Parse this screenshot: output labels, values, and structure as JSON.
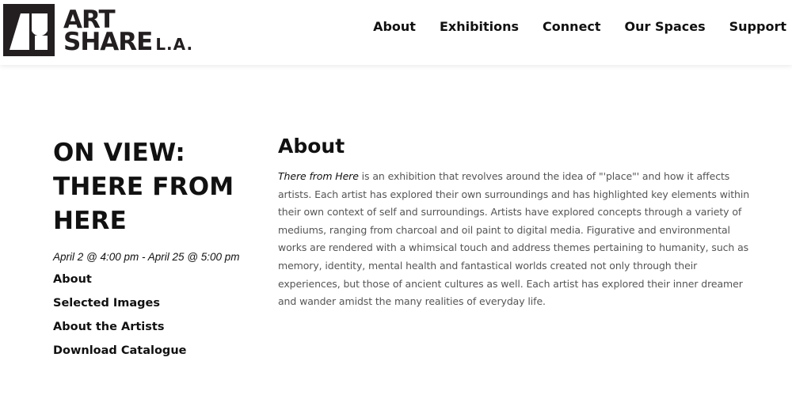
{
  "header": {
    "logo": {
      "line1": "ART",
      "line2": "SHARE",
      "suffix": "L.A."
    },
    "nav": [
      {
        "label": "About"
      },
      {
        "label": "Exhibitions"
      },
      {
        "label": "Connect"
      },
      {
        "label": "Our Spaces"
      },
      {
        "label": "Support"
      }
    ]
  },
  "sidebar": {
    "title": "ON VIEW: THERE FROM HERE",
    "date": "April 2 @ 4:00 pm - April 25 @ 5:00 pm",
    "links": [
      {
        "label": "About"
      },
      {
        "label": "Selected Images"
      },
      {
        "label": "About the Artists"
      },
      {
        "label": "Download Catalogue"
      }
    ]
  },
  "main": {
    "heading": "About",
    "intro_italic": "There from Here",
    "body": " is an exhibition that revolves around the idea of \"'place\"' and how it affects artists.  Each artist has explored their own surroundings and has highlighted key elements within their own context of self and surroundings.  Artists have explored concepts through a variety of mediums, ranging from charcoal and oil paint to digital media. Figurative and environmental works are rendered with a whimsical touch and address themes pertaining to humanity, such as memory, identity, mental health and fantastical worlds created not only through their experiences, but those of ancient cultures as well. Each artist has explored their inner dreamer and wander amidst the many realities of everyday life."
  }
}
